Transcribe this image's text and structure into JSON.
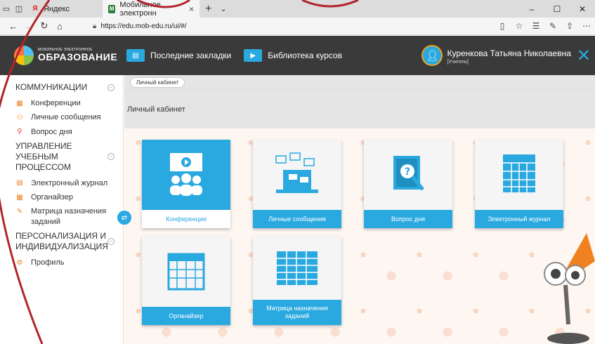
{
  "browser": {
    "tabs": [
      {
        "label": "Яндекс",
        "favicon": "Я",
        "active": false
      },
      {
        "label": "Мобильное электронн",
        "favicon": "M",
        "active": true
      }
    ],
    "url": "https://edu.mob-edu.ru/ui/#/"
  },
  "header": {
    "logo_small": "МОБИЛЬНОЕ ЭЛЕКТРОННОЕ",
    "logo_big": "ОБРАЗОВАНИЕ",
    "bookmarks_label": "Последние закладки",
    "library_label": "Библиотека курсов",
    "user_name": "Куренкова Татьяна Николаевна",
    "user_role": "[Учитель]"
  },
  "sidebar": {
    "sections": [
      {
        "title": "КОММУНИКАЦИИ",
        "items": [
          "Конференции",
          "Личные сообщения",
          "Вопрос дня"
        ]
      },
      {
        "title": "УПРАВЛЕНИЕ УЧЕБНЫМ ПРОЦЕССОМ",
        "items": [
          "Электронный журнал",
          "Органайзер",
          "Матрица назначения заданий"
        ]
      },
      {
        "title": "ПЕРСОНАЛИЗАЦИЯ И ИНДИВИДУАЛИЗАЦИЯ",
        "items": [
          "Профиль"
        ]
      }
    ]
  },
  "main": {
    "breadcrumb": "Личный кабинет",
    "page_title": "Личный кабинет",
    "tiles": [
      {
        "label": "Конференции",
        "active": true
      },
      {
        "label": "Личные сообщения"
      },
      {
        "label": "Вопрос дня"
      },
      {
        "label": "Электронный журнал"
      },
      {
        "label": "Органайзер"
      },
      {
        "label": "Матрица назначения заданий"
      }
    ]
  },
  "colors": {
    "accent": "#2aa9e0",
    "header_bg": "#3a3a3a",
    "orange": "#f08020"
  }
}
